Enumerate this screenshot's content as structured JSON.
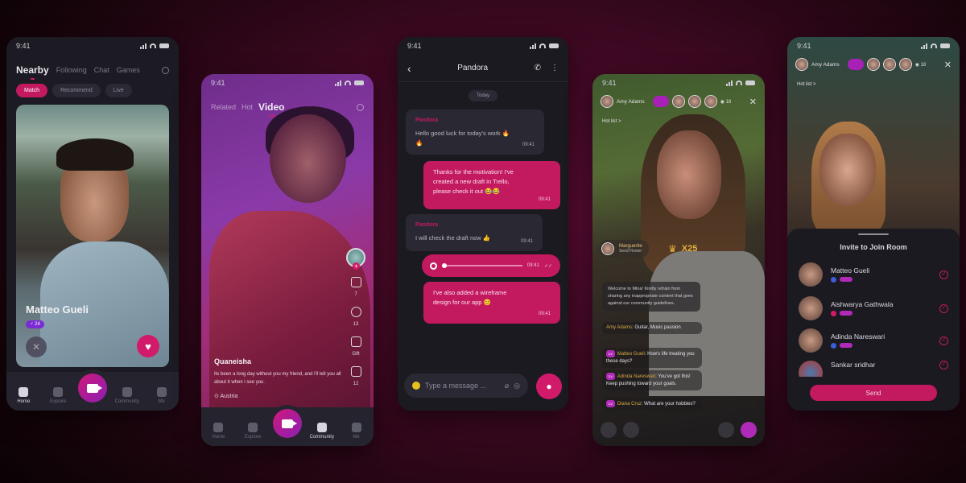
{
  "status_time": "9:41",
  "nearby_screen": {
    "tabs": [
      "Nearby",
      "Following",
      "Chat",
      "Games"
    ],
    "chips": [
      "Match",
      "Recommend",
      "Live"
    ],
    "profile_name": "Matteo Gueli",
    "profile_age": "24",
    "nav": [
      "Home",
      "Explore",
      "Community",
      "Me"
    ]
  },
  "video_screen": {
    "tabs": [
      "Related",
      "Hot",
      "Video"
    ],
    "actions": {
      "likes": "7",
      "comments": "13",
      "gift": "Gift",
      "shares": "12"
    },
    "author": "Quaneisha",
    "caption": "Its been a long day without you my friend, and i'll tell you all about it when i see you .",
    "location": "Austria",
    "nav": [
      "Home",
      "Explore",
      "Community",
      "Me"
    ]
  },
  "chat_screen": {
    "contact": "Pandora",
    "date_label": "Today",
    "messages": [
      {
        "dir": "in",
        "sender": "Pandora",
        "text": "Hello good luck for today's work 🔥🔥",
        "time": "09:41"
      },
      {
        "dir": "out",
        "text": "Thanks for the motivation! I've created a new draft in Trello, please check it out 😂😂",
        "time": "09:41"
      },
      {
        "dir": "in",
        "sender": "Pandora",
        "text": "I will check the draft now 👍",
        "time": "09:41"
      },
      {
        "dir": "out",
        "type": "voice",
        "time": "09:41"
      },
      {
        "dir": "out",
        "text": "I've also added a wireframe design for our app 😊",
        "time": "09:41"
      }
    ],
    "input_placeholder": "Type a message ..."
  },
  "live_screen": {
    "host_name": "Amy Adams",
    "viewer_count": "18",
    "hot_list_label": "Hot list >",
    "gift_sender": "Marguerite",
    "gift_sub": "Send Flower",
    "gift_multiplier": "X25",
    "system_message": "Welcome to Mina! Kindly refrain from sharing any inappropriate content that goes against our community guidelines.",
    "comments": [
      {
        "user": "Amy Adams",
        "text": "Guitar, Music passion"
      },
      {
        "user": "Matteo Gueli",
        "text": "How's life treating you these days?"
      },
      {
        "user": "Adinda Nareswari",
        "text": "You've got this! Keep pushing toward your goals."
      },
      {
        "user": "Diana Cruz",
        "text": "What are your hobbies?"
      }
    ]
  },
  "invite_screen": {
    "host_name": "Amy Adams",
    "viewer_count": "18",
    "hot_list_label": "Hot list >",
    "title": "Invite to Join Room",
    "users": [
      "Matteo Gueli",
      "Aishwarya Gathwala",
      "Adinda Nareswari",
      "Sankar sridhar"
    ],
    "send_label": "Send"
  },
  "accent_color": "#c3195f"
}
